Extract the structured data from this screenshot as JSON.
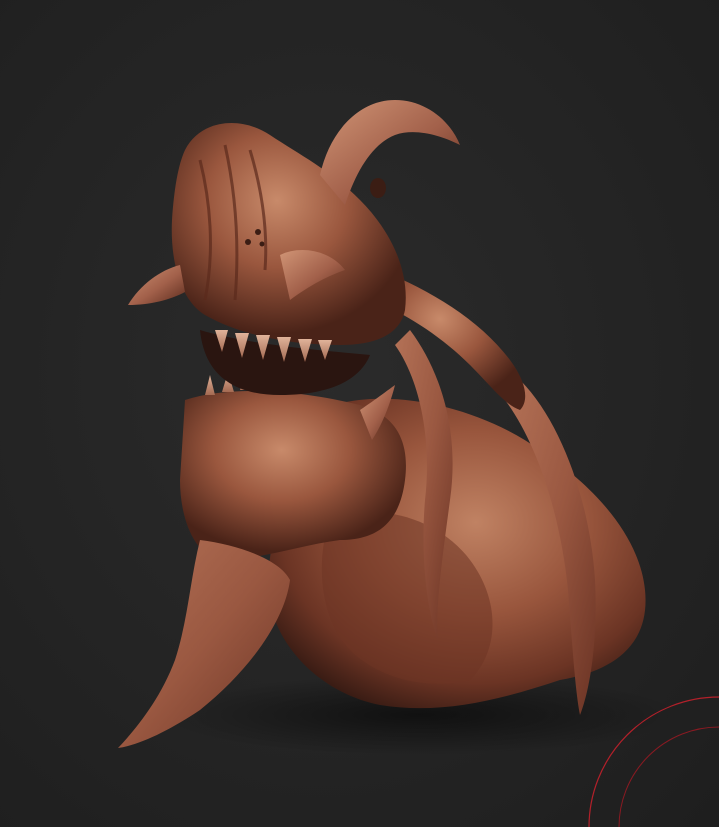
{
  "scene": {
    "subject": "sculpted-creature-bust",
    "background_color": "#232323",
    "clay_base_color": "#8a4a35",
    "clay_highlight_color": "#c98a6a",
    "clay_shadow_color": "#3a1c14",
    "accent_arc_color": "#b3202a"
  }
}
